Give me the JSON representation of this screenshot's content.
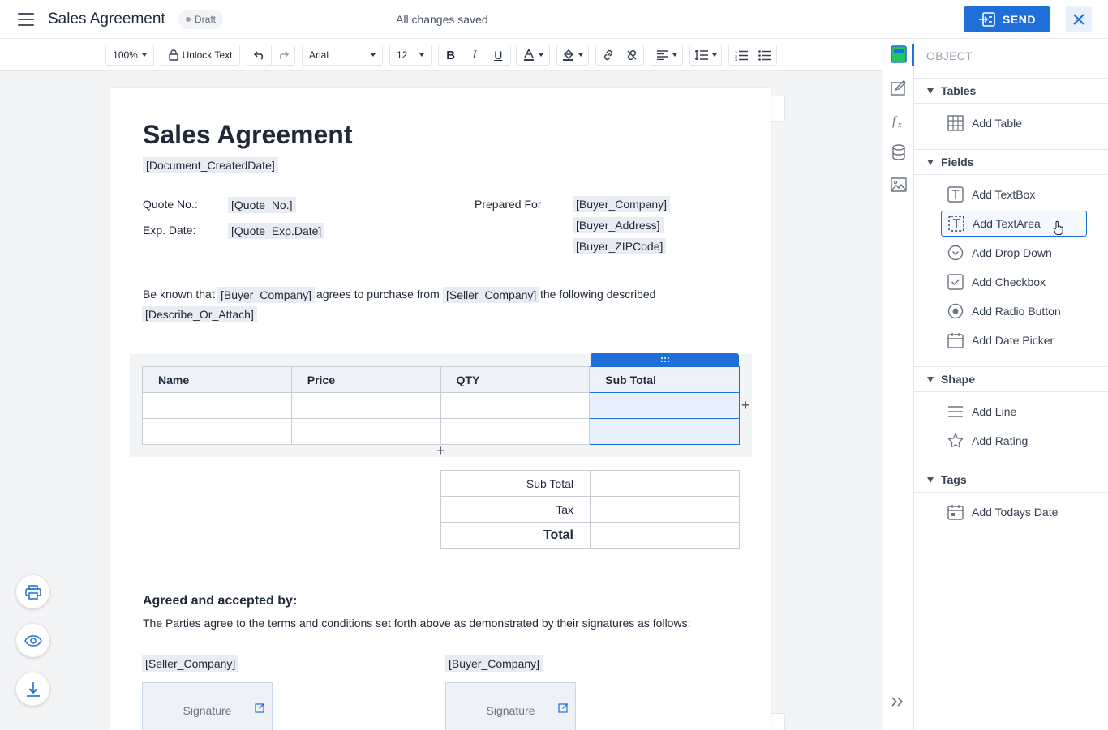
{
  "header": {
    "title": "Sales Agreement",
    "status_badge": "Draft",
    "save_status": "All changes saved",
    "send_label": "SEND"
  },
  "toolbar": {
    "zoom": "100%",
    "unlock_label": "Unlock Text",
    "font_family": "Arial",
    "font_size": "12"
  },
  "document": {
    "title": "Sales Agreement",
    "created_date": "[Document_CreatedDate]",
    "quote_no_label": "Quote No.:",
    "quote_no_field": "[Quote_No.]",
    "exp_date_label": "Exp. Date:",
    "exp_date_field": "[Quote_Exp.Date]",
    "prepared_for_label": "Prepared For",
    "buyer_company": "[Buyer_Company]",
    "buyer_address": "[Buyer_Address]",
    "buyer_zip": "[Buyer_ZIPCode]",
    "para_1": "Be known that",
    "para_buyer": "[Buyer_Company]",
    "para_2": "agrees to purchase from",
    "para_seller": "[Seller_Company]",
    "para_3": "the following described",
    "para_describe": "[Describe_Or_Attach]",
    "table_headers": [
      "Name",
      "Price",
      "QTY",
      "Sub Total"
    ],
    "totals": {
      "subtotal_label": "Sub Total",
      "tax_label": "Tax",
      "total_label": "Total"
    },
    "agreed_heading": "Agreed and accepted by:",
    "agreed_text": "The Parties agree to the terms and conditions set forth above as demonstrated by their signatures as follows:",
    "seller_company": "[Seller_Company]",
    "buyer_company_sig": "[Buyer_Company]",
    "signature_label": "Signature"
  },
  "panel": {
    "heading": "OBJECT",
    "sections": {
      "tables": "Tables",
      "fields": "Fields",
      "shape": "Shape",
      "tags": "Tags"
    },
    "items": {
      "add_table": "Add Table",
      "add_textbox": "Add TextBox",
      "add_textarea": "Add TextArea",
      "add_dropdown": "Add Drop Down",
      "add_checkbox": "Add Checkbox",
      "add_radio": "Add Radio Button",
      "add_datepicker": "Add Date Picker",
      "add_line": "Add Line",
      "add_rating": "Add Rating",
      "add_todays_date": "Add Todays Date"
    }
  },
  "colors": {
    "accent": "#1e6fd9",
    "field_bg": "#e9edf3",
    "canvas_bg": "#f3f4f6"
  }
}
